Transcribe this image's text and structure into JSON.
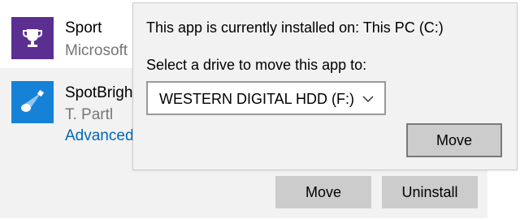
{
  "apps": [
    {
      "name": "Sport",
      "publisher": "Microsoft",
      "icon": "trophy-icon",
      "icon_bg": "#5b2f91"
    },
    {
      "name": "SpotBrigh",
      "publisher": "T. Partl",
      "link": "Advanced",
      "icon": "spotlight-icon",
      "icon_bg": "#1582d8",
      "buttons": {
        "move": "Move",
        "uninstall": "Uninstall"
      }
    }
  ],
  "flyout": {
    "installed_text": "This app is currently installed on: This PC (C:)",
    "select_label": "Select a drive to move this app to:",
    "selected_drive": "WESTERN DIGITAL HDD (F:)",
    "move_label": "Move"
  },
  "colors": {
    "accent_link": "#0067b8",
    "button_gray": "#cccccc",
    "secondary_text": "#767676"
  }
}
